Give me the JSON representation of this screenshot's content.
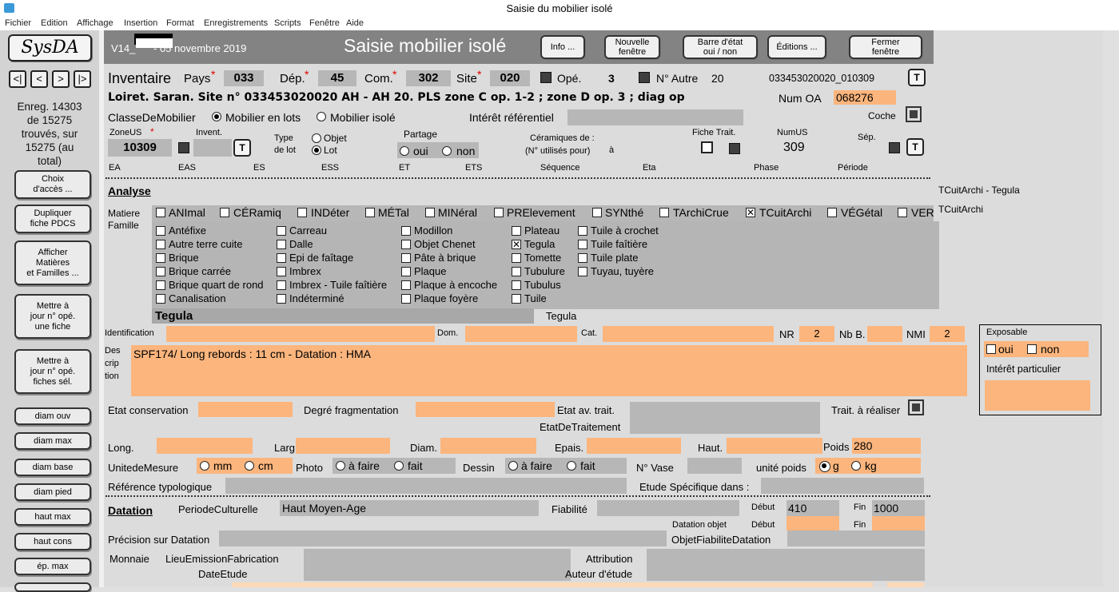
{
  "window": {
    "title": "Saisie du mobilier isolé"
  },
  "menu": [
    "Fichier",
    "Edition",
    "Affichage",
    "Insertion",
    "Format",
    "Enregistrements",
    "Scripts",
    "Fenêtre",
    "Aide"
  ],
  "sidebar": {
    "logo": "SysDA",
    "nav": [
      "<|",
      "<",
      ">",
      "|>"
    ],
    "record_info": "Enreg. 14303\nde 15275\ntrouvés, sur\n15275 (au\ntotal)",
    "buttons": [
      "Choix\nd'accès ...",
      "Dupliquer\nfiche PDCS",
      "Afficher\nMatières\net Familles ...",
      "Mettre à\njour n° opé.\nune fiche",
      "Mettre à\njour n° opé.\nfiches sél.",
      "diam ouv",
      "diam max",
      "diam base",
      "diam pied",
      "haut max",
      "haut cons",
      "ép. max"
    ]
  },
  "header": {
    "version_a": "V14_",
    "version_b": "- 05 novembre 2019",
    "title": "Saisie mobilier isolé",
    "buttons": {
      "info": "Info ...",
      "new_window": "Nouvelle\nfenêtre",
      "status_bar": "Barre d'état\noui / non",
      "editions": "Éditions ...",
      "close": "Fermer\nfenêtre"
    }
  },
  "inventaire": {
    "label": "Inventaire",
    "pays_label": "Pays",
    "pays": "033",
    "dep_label": "Dép.",
    "dep": "45",
    "com_label": "Com.",
    "com": "302",
    "site_label": "Site",
    "site": "020",
    "ope_label": "Opé.",
    "ope": "3",
    "autre_label": "N° Autre",
    "autre": "20",
    "code": "033453020020_010309",
    "t": "T",
    "required": "*"
  },
  "site_line": "Loiret. Saran. Site n° 033453020020 AH - AH 20. PLS zone C op. 1-2 ; zone D op. 3 ; diag op",
  "num_oa": {
    "label": "Num OA",
    "value": "068276"
  },
  "classe": {
    "label": "ClasseDeMobilier",
    "opt1": "Mobilier en lots",
    "opt2": "Mobilier isolé",
    "interet": "Intérêt référentiel",
    "coche": "Coche"
  },
  "zoneus": {
    "label": "ZoneUS",
    "value": "10309",
    "invent": "Invent.",
    "type_label": "Type",
    "type_label2": "de lot",
    "objet": "Objet",
    "lot": "Lot",
    "partage": "Partage",
    "oui": "oui",
    "non": "non",
    "ceram": "Céramiques de :",
    "ceram2": "(N° utilisés pour)",
    "a": "à",
    "fiche": "Fiche Trait.",
    "numus_label": "NumUS",
    "numus": "309",
    "sep": "Sép."
  },
  "strat": [
    "EA",
    "EAS",
    "ES",
    "ESS",
    "ET",
    "ETS",
    "Séquence",
    "Eta",
    "Phase",
    "Période"
  ],
  "analyse": {
    "title": "Analyse",
    "right1": "TCuitArchi - Tegula",
    "right2": "TCuitArchi",
    "matiere": "Matiere",
    "famille": "Famille",
    "materials": [
      "ANImal",
      "CÉRamiq",
      "INDéter",
      "MÉTal",
      "MINéral",
      "PRElevement",
      "SYNthé",
      "TArchiCrue",
      "TCuitArchi",
      "VÉGétal",
      "VER"
    ],
    "families": [
      [
        "Antéfixe",
        "Autre terre cuite",
        "Brique",
        "Brique carrée",
        "Brique quart de rond",
        "Canalisation"
      ],
      [
        "Carreau",
        "Dalle",
        "Epi de faîtage",
        "Imbrex",
        "Imbrex - Tuile faîtière",
        "Indéterminé"
      ],
      [
        "Modillon",
        "Objet Chenet",
        "Pâte à brique",
        "Plaque",
        "Plaque à encoche",
        "Plaque foyère"
      ],
      [
        "Plateau",
        "Tegula",
        "Tomette",
        "Tubulure",
        "Tubulus",
        "Tuile"
      ],
      [
        "Tuile à crochet",
        "Tuile faîtière",
        "Tuile plate",
        "Tuyau, tuyère"
      ]
    ],
    "selected": "Tegula",
    "selected2": "Tegula"
  },
  "ident": {
    "label": "Identification",
    "dom": "Dom.",
    "cat": "Cat.",
    "nr_label": "NR",
    "nr": "2",
    "nbb": "Nb B.",
    "nmi_label": "NMI",
    "nmi": "2"
  },
  "desc": {
    "l1": "Des",
    "l2": "crip",
    "l3": "tion",
    "value": "SPF174/ Long rebords : 11 cm - Datation : HMA"
  },
  "exposable": {
    "title": "Exposable",
    "oui": "oui",
    "non": "non",
    "interet": "Intérêt particulier"
  },
  "etat": {
    "cons": "Etat conservation",
    "frag": "Degré fragmentation",
    "avtrait": "Etat av. trait.",
    "traitement": "EtatDeTraitement",
    "trait": "Trait. à réaliser"
  },
  "dims": {
    "long": "Long.",
    "larg": "Larg.",
    "diam": "Diam.",
    "epais": "Epais.",
    "haut": "Haut.",
    "poids": "Poids",
    "poids_value": "280"
  },
  "unite": {
    "label": "UnitedeMesure",
    "mm": "mm",
    "cm": "cm",
    "photo": "Photo",
    "afaire": "à faire",
    "fait": "fait",
    "dessin": "Dessin",
    "vase": "N° Vase",
    "poids_unit": "unité poids",
    "g": "g",
    "kg": "kg"
  },
  "ref": {
    "label": "Référence typologique",
    "etude": "Etude Spécifique dans :"
  },
  "datation": {
    "title": "Datation",
    "periode_label": "PeriodeCulturelle",
    "periode": "Haut Moyen-Age",
    "fiabilite": "Fiabilité",
    "debut": "Début",
    "debut_value": "410",
    "fin": "Fin",
    "fin_value": "1000",
    "dat_objet": "Datation objet",
    "precision": "Précision sur Datation",
    "objfiab": "ObjetFiabiliteDatation",
    "monnaie": "Monnaie",
    "lieu": "LieuEmissionFabrication",
    "attribution": "Attribution",
    "dateetude": "DateEtude",
    "auteur": "Auteur d'étude"
  }
}
